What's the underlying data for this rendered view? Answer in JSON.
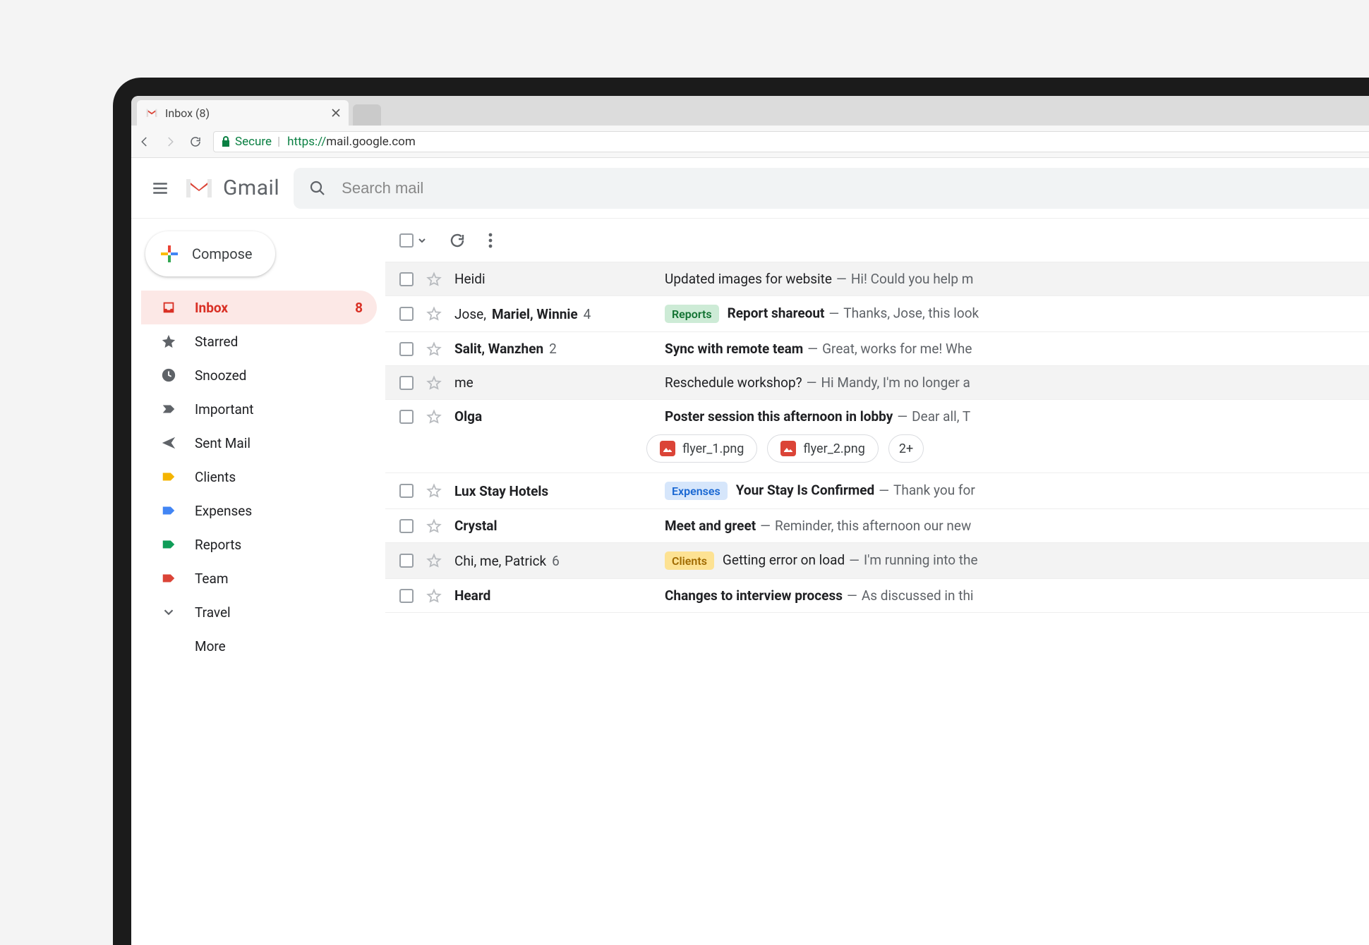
{
  "browser": {
    "tab_title": "Inbox (8)",
    "secure_label": "Secure",
    "url_https": "https://",
    "url_rest": "mail.google.com"
  },
  "header": {
    "product": "Gmail",
    "search_placeholder": "Search mail"
  },
  "compose": {
    "label": "Compose"
  },
  "sidebar": {
    "items": [
      {
        "label": "Inbox",
        "active": true,
        "count": "8"
      },
      {
        "label": "Starred"
      },
      {
        "label": "Snoozed"
      },
      {
        "label": "Important"
      },
      {
        "label": "Sent Mail"
      },
      {
        "label": "Clients"
      },
      {
        "label": "Expenses"
      },
      {
        "label": "Reports"
      },
      {
        "label": "Team"
      },
      {
        "label": "Travel"
      },
      {
        "label": "More"
      }
    ]
  },
  "mail": [
    {
      "sender": "Heidi",
      "bold_sender": false,
      "subject": "Updated images for website",
      "bold_subject": false,
      "snippet": "Hi! Could you help m",
      "shade": true
    },
    {
      "sender_pre": "Jose, ",
      "sender_bold": "Mariel, Winnie",
      "count": "4",
      "tag": "Reports",
      "tag_class": "reports",
      "subject": "Report shareout",
      "snippet": "Thanks, Jose, this look"
    },
    {
      "sender_bold": "Salit, Wanzhen",
      "count": "2",
      "subject": "Sync with remote team",
      "snippet": "Great, works for me! Whe"
    },
    {
      "sender": "me",
      "bold_sender": false,
      "subject": "Reschedule workshop?",
      "bold_subject": false,
      "snippet": "Hi Mandy, I'm no longer a",
      "shade": true
    },
    {
      "sender_bold": "Olga",
      "subject": "Poster session this afternoon in lobby",
      "snippet": "Dear all, T",
      "attachments": [
        "flyer_1.png",
        "flyer_2.png"
      ],
      "attachment_overflow": "2+"
    },
    {
      "sender_bold": "Lux Stay Hotels",
      "tag": "Expenses",
      "tag_class": "expenses",
      "subject": "Your Stay Is Confirmed",
      "snippet": "Thank you for"
    },
    {
      "sender_bold": "Crystal",
      "subject": "Meet and greet",
      "snippet": "Reminder, this afternoon our new"
    },
    {
      "sender": "Chi, me, Patrick",
      "bold_sender": false,
      "count": "6",
      "tag": "Clients",
      "tag_class": "clients",
      "subject": "Getting error on load",
      "bold_subject": false,
      "snippet": "I'm running into the",
      "shade": true
    },
    {
      "sender_bold": "Heard",
      "subject": "Changes to interview process",
      "snippet": "As discussed in thi"
    }
  ]
}
